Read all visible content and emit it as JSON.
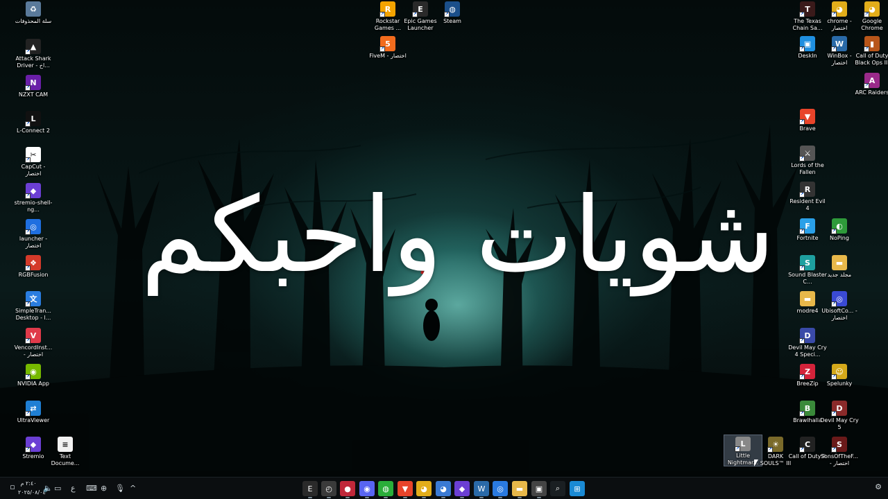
{
  "wallpaper": {
    "overlay_text": "شويات واحبكم"
  },
  "desktop_icons": [
    {
      "label": "سلة المحذوفات",
      "icon": "recycle-bin-icon",
      "color": "#5a7a9a",
      "glyph": "♻"
    },
    {
      "label": "Attack Shark Driver - اخ...",
      "icon": "attack-shark-icon",
      "color": "#222222",
      "glyph": "▲"
    },
    {
      "label": "NZXT CAM",
      "icon": "nzxt-cam-icon",
      "color": "#6a1fa8",
      "glyph": "N"
    },
    {
      "label": "L-Connect 2",
      "icon": "l-connect-icon",
      "color": "#111111",
      "glyph": "L"
    },
    {
      "label": "CapCut - اختصار",
      "icon": "capcut-icon",
      "color": "#ffffff",
      "glyph": "✂"
    },
    {
      "label": "stremio-shell-ng...",
      "icon": "stremio-shell-icon",
      "color": "#6b3fd4",
      "glyph": "◆"
    },
    {
      "label": "launcher - اختصار",
      "icon": "launcher-icon",
      "color": "#1f6fe0",
      "glyph": "◎"
    },
    {
      "label": "RGBFusion",
      "icon": "rgbfusion-icon",
      "color": "#d43a2a",
      "glyph": "❖"
    },
    {
      "label": "SimpleTran... Desktop - ا...",
      "icon": "simpletranslate-icon",
      "color": "#2a7de0",
      "glyph": "文"
    },
    {
      "label": "VencordInst... - اختصار",
      "icon": "vencord-icon",
      "color": "#e03a4a",
      "glyph": "V"
    },
    {
      "label": "NVIDIA App",
      "icon": "nvidia-icon",
      "color": "#76b900",
      "glyph": "◉"
    },
    {
      "label": "UltraViewer",
      "icon": "ultraviewer-icon",
      "color": "#1f7fd4",
      "glyph": "⇄"
    },
    {
      "label": "Stremio",
      "icon": "stremio-icon",
      "color": "#6b3fd4",
      "glyph": "◆"
    },
    {
      "label": "Text Docume...",
      "icon": "text-document-icon",
      "color": "#f2f2f2",
      "glyph": "≡"
    },
    {
      "label": "Rockstar Games ...",
      "icon": "rockstar-icon",
      "color": "#f4a300",
      "glyph": "R"
    },
    {
      "label": "Epic Games Launcher",
      "icon": "epic-games-icon",
      "color": "#2a2a2a",
      "glyph": "E"
    },
    {
      "label": "Steam",
      "icon": "steam-icon",
      "color": "#1b4f8a",
      "glyph": "◍"
    },
    {
      "label": "FiveM - اختصار",
      "icon": "fivem-icon",
      "color": "#f26b1d",
      "glyph": "5"
    },
    {
      "label": "The Texas Chain Sa...",
      "icon": "texas-chainsaw-icon",
      "color": "#3a1a1a",
      "glyph": "T"
    },
    {
      "label": "chrome - اختصار",
      "icon": "chrome-shortcut-icon",
      "color": "#e2ad1a",
      "glyph": "◕"
    },
    {
      "label": "Google Chrome",
      "icon": "google-chrome-icon",
      "color": "#e2ad1a",
      "glyph": "◕"
    },
    {
      "label": "DeskIn",
      "icon": "deskin-icon",
      "color": "#1f8fe0",
      "glyph": "▣"
    },
    {
      "label": "WinBox - اختصار",
      "icon": "winbox-icon",
      "color": "#2a6aa8",
      "glyph": "W"
    },
    {
      "label": "Call of Duty Black Ops III",
      "icon": "black-ops-icon",
      "color": "#b8561a",
      "glyph": "▮"
    },
    {
      "label": "ARC Raiders",
      "icon": "arc-raiders-icon",
      "color": "#9a2a8a",
      "glyph": "A"
    },
    {
      "label": "Brave",
      "icon": "brave-icon",
      "color": "#e8442a",
      "glyph": "▼"
    },
    {
      "label": "Lords of the Fallen",
      "icon": "lords-fallen-icon",
      "color": "#555555",
      "glyph": "⚔"
    },
    {
      "label": "Resident Evil 4",
      "icon": "resident-evil-icon",
      "color": "#333333",
      "glyph": "R"
    },
    {
      "label": "Fortnite",
      "icon": "fortnite-icon",
      "color": "#2aa0e8",
      "glyph": "F"
    },
    {
      "label": "NoPing",
      "icon": "noping-icon",
      "color": "#2e9a3a",
      "glyph": "◐"
    },
    {
      "label": "Sound Blaster C...",
      "icon": "sound-blaster-icon",
      "color": "#1ea0a0",
      "glyph": "S"
    },
    {
      "label": "مجلد جديد",
      "icon": "new-folder-icon",
      "color": "#e8b84a",
      "glyph": "▬"
    },
    {
      "label": "modre4",
      "icon": "folder-icon",
      "color": "#e8b84a",
      "glyph": "▬"
    },
    {
      "label": "UbisoftCo... - اختصار",
      "icon": "ubisoft-icon",
      "color": "#3a4ad4",
      "glyph": "◎"
    },
    {
      "label": "Devil May Cry 4 Speci...",
      "icon": "dmc4-icon",
      "color": "#3a4aa8",
      "glyph": "D"
    },
    {
      "label": "BreeZip",
      "icon": "breezip-icon",
      "color": "#d4233a",
      "glyph": "Z"
    },
    {
      "label": "Spelunky",
      "icon": "spelunky-icon",
      "color": "#d4a81a",
      "glyph": "☺"
    },
    {
      "label": "Brawlhalla",
      "icon": "brawlhalla-icon",
      "color": "#3a8a3a",
      "glyph": "B"
    },
    {
      "label": "Devil May Cry 5",
      "icon": "dmc5-icon",
      "color": "#8a2a2a",
      "glyph": "D"
    },
    {
      "label": "Little Nightmar...",
      "icon": "little-nightmares-icon",
      "color": "#888888",
      "glyph": "L"
    },
    {
      "label": "DARK SOULS™ III",
      "icon": "dark-souls-icon",
      "color": "#7a6a2a",
      "glyph": "☀"
    },
    {
      "label": "Call of Duty®",
      "icon": "call-of-duty-icon",
      "color": "#222222",
      "glyph": "C"
    },
    {
      "label": "SonsOfTheF... - اختصار",
      "icon": "sons-forest-icon",
      "color": "#6a1a1a",
      "glyph": "S"
    }
  ],
  "taskbar": {
    "clock_time": "٢:٤٠ م",
    "clock_date": "٢٠٢٥/٠٨/٠٤",
    "tray_icons": [
      {
        "name": "speaker-icon",
        "glyph": "🔈"
      },
      {
        "name": "display-icon",
        "glyph": "▭"
      },
      {
        "name": "language-indicator",
        "glyph": "ع"
      },
      {
        "name": "keyboard-icon",
        "glyph": "⌨"
      },
      {
        "name": "network-icon",
        "glyph": "⊕"
      },
      {
        "name": "microphone-icon",
        "glyph": "🎙"
      },
      {
        "name": "show-hidden-icons-chevron",
        "glyph": "^"
      }
    ],
    "apps": [
      {
        "name": "epic-games-taskbar",
        "color": "#2a2a2a",
        "glyph": "E"
      },
      {
        "name": "clock-app-taskbar",
        "color": "#3a3a3a",
        "glyph": "◴"
      },
      {
        "name": "record-app-taskbar",
        "color": "#c0283a",
        "glyph": "●"
      },
      {
        "name": "discord-taskbar",
        "color": "#5865f2",
        "glyph": "◉"
      },
      {
        "name": "wechat-taskbar",
        "color": "#2aae3a",
        "glyph": "◍"
      },
      {
        "name": "brave-taskbar",
        "color": "#e8442a",
        "glyph": "▼"
      },
      {
        "name": "chrome-taskbar",
        "color": "#e2ad1a",
        "glyph": "◕"
      },
      {
        "name": "chrome-2-taskbar",
        "color": "#3a7ad4",
        "glyph": "◕"
      },
      {
        "name": "stremio-taskbar",
        "color": "#6b3fd4",
        "glyph": "◆"
      },
      {
        "name": "winbox-taskbar",
        "color": "#2a6aa8",
        "glyph": "W"
      },
      {
        "name": "browser-taskbar",
        "color": "#2a7ae0",
        "glyph": "◎"
      },
      {
        "name": "file-explorer-taskbar",
        "color": "#e8b84a",
        "glyph": "▬"
      },
      {
        "name": "task-view-taskbar",
        "color": "#444444",
        "glyph": "▣"
      },
      {
        "name": "search-taskbar",
        "color": "#1a1f22",
        "glyph": "⌕"
      },
      {
        "name": "start-button",
        "color": "#1a8ad4",
        "glyph": "⊞"
      }
    ]
  }
}
